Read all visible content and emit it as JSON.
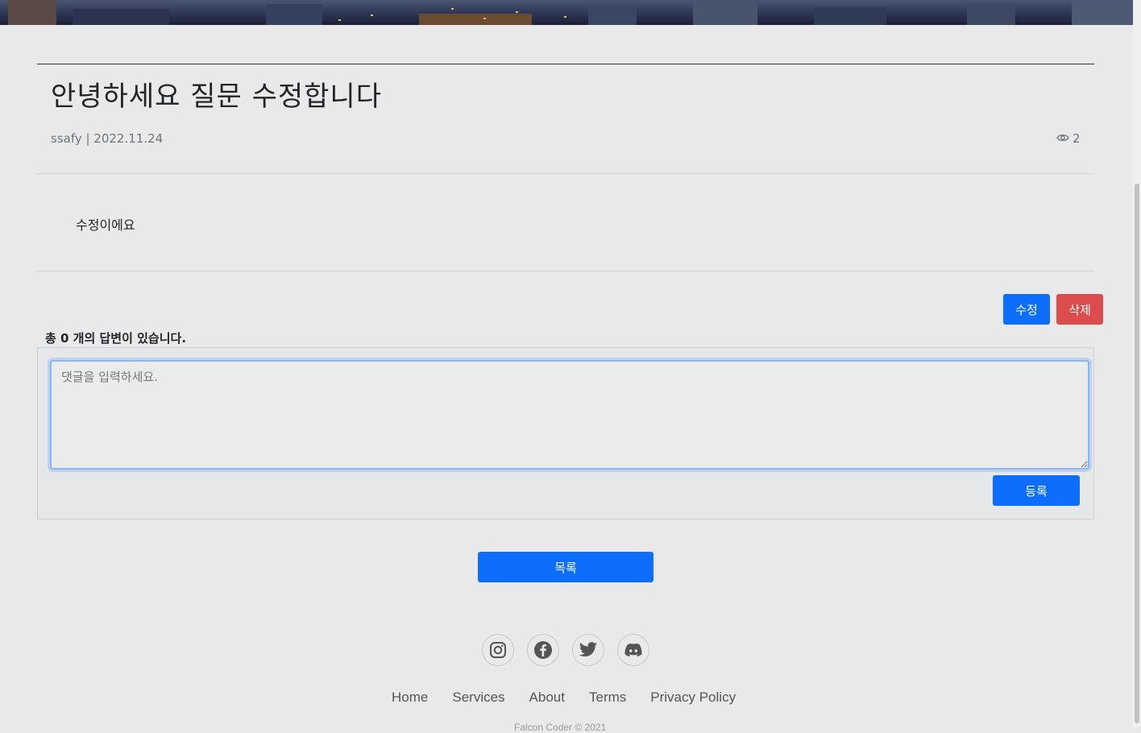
{
  "post": {
    "title": "안녕하세요 질문 수정합니다",
    "meta": "ssafy | 2022.11.24",
    "views": "2",
    "content": "수정이에요"
  },
  "actions": {
    "edit_label": "수정",
    "delete_label": "삭제"
  },
  "comments": {
    "count_label": "총 0 개의 답변이 있습니다.",
    "placeholder": "댓글을 입력하세요.",
    "submit_label": "등록"
  },
  "list_button_label": "목록",
  "footer": {
    "socials": [
      "instagram-icon",
      "facebook-icon",
      "twitter-icon",
      "discord-icon"
    ],
    "links": [
      "Home",
      "Services",
      "About",
      "Terms",
      "Privacy Policy"
    ],
    "copyright": "Falcon Coder © 2021"
  },
  "colors": {
    "primary": "#0d6efd",
    "danger": "#dc4c4c",
    "background": "#e9e9e9"
  }
}
